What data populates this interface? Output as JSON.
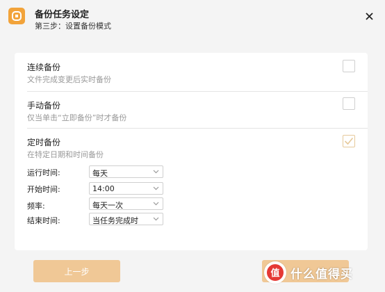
{
  "window": {
    "title": "备份任务设定",
    "subtitle": "第三步：设置备份模式",
    "logo_icon": "app-logo-icon",
    "close_icon": "close-icon"
  },
  "options": [
    {
      "title": "连续备份",
      "desc": "文件完成变更后实时备份",
      "checked": false
    },
    {
      "title": "手动备份",
      "desc": "仅当单击“立即备份”时才备份",
      "checked": false
    },
    {
      "title": "定时备份",
      "desc": "在特定日期和时间备份",
      "checked": true
    }
  ],
  "schedule": [
    {
      "label": "运行时间:",
      "value": "每天"
    },
    {
      "label": "开始时间:",
      "value": "14:00"
    },
    {
      "label": "频率:",
      "value": "每天一次"
    },
    {
      "label": "结束时间:",
      "value": "当任务完成时"
    }
  ],
  "buttons": {
    "prev": "上一步"
  },
  "watermark": {
    "badge": "值",
    "text": "什么值得买"
  },
  "colors": {
    "accent": "#f2a33a",
    "button": "#f0c896",
    "check": "#e6c99a"
  }
}
